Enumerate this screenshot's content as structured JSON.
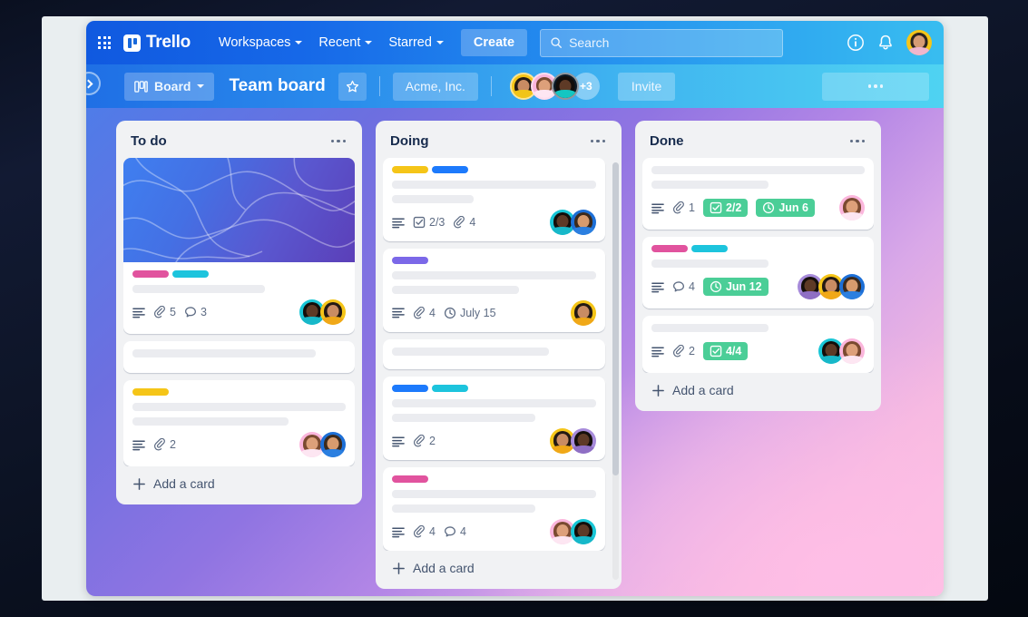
{
  "topnav": {
    "apps_icon": "apps-grid-icon",
    "brand": "Trello",
    "items": [
      {
        "label": "Workspaces",
        "has_caret": true
      },
      {
        "label": "Recent",
        "has_caret": true
      },
      {
        "label": "Starred",
        "has_caret": true
      }
    ],
    "create_label": "Create",
    "search_placeholder": "Search",
    "search_value": "",
    "info_icon": "info-icon",
    "bell_icon": "notifications-bell-icon",
    "avatar": "user-avatar"
  },
  "board_header": {
    "sidebar_toggle": "sidebar-expand-icon",
    "view_label": "Board",
    "title": "Team board",
    "star_icon": "star-icon",
    "workspace": "Acme, Inc.",
    "members_overflow": "+3",
    "invite_label": "Invite",
    "menu_icon": "board-menu-ellipsis"
  },
  "colors": {
    "brand_blue": "#1868db",
    "label_pink": "#e1539e",
    "label_cyan": "#1dc4dd",
    "label_yellow": "#f5c518",
    "label_blue": "#1d7afc",
    "label_purple": "#7b68e8",
    "badge_green": "#4bce97",
    "list_bg": "#f1f2f4",
    "card_bg": "#ffffff",
    "text_dark": "#172b4d",
    "text_muted": "#5e6c84"
  },
  "lists": [
    {
      "title": "To do",
      "add_card_label": "Add a card",
      "scrollbar": false,
      "cards": [
        {
          "cover": true,
          "labels": [
            "#e1539e",
            "#1dc4dd"
          ],
          "placeholder_lines": [
            62
          ],
          "badges": [
            {
              "type": "description"
            },
            {
              "type": "attachment",
              "value": "5"
            },
            {
              "type": "comment",
              "value": "3"
            }
          ],
          "members": [
            "cyan-dark",
            "yellow-dark"
          ]
        },
        {
          "cover": false,
          "labels": [],
          "placeholder_lines": [
            86
          ],
          "badges": [],
          "members": []
        },
        {
          "cover": false,
          "labels": [
            "#f5c518"
          ],
          "placeholder_lines": [
            100,
            73
          ],
          "badges": [
            {
              "type": "description"
            },
            {
              "type": "attachment",
              "value": "2"
            }
          ],
          "members": [
            "pink-light",
            "blue-mid"
          ]
        }
      ]
    },
    {
      "title": "Doing",
      "add_card_label": "Add a card",
      "scrollbar": true,
      "cards": [
        {
          "cover": false,
          "labels": [
            "#f5c518",
            "#1d7afc"
          ],
          "placeholder_lines": [
            100,
            40
          ],
          "badges": [
            {
              "type": "description"
            },
            {
              "type": "checklist",
              "value": "2/3"
            },
            {
              "type": "attachment",
              "value": "4"
            }
          ],
          "members": [
            "cyan-dark",
            "blue-mid"
          ]
        },
        {
          "cover": false,
          "labels": [
            "#7b68e8"
          ],
          "placeholder_lines": [
            100,
            62
          ],
          "badges": [
            {
              "type": "description"
            },
            {
              "type": "attachment",
              "value": "4"
            },
            {
              "type": "due",
              "value": "July 15"
            }
          ],
          "members": [
            "yellow-dark"
          ]
        },
        {
          "cover": false,
          "labels": [],
          "placeholder_lines": [
            77
          ],
          "badges": [],
          "members": []
        },
        {
          "cover": false,
          "labels": [
            "#1d7afc",
            "#1dc4dd"
          ],
          "placeholder_lines": [
            100,
            70
          ],
          "badges": [
            {
              "type": "description"
            },
            {
              "type": "attachment",
              "value": "2"
            }
          ],
          "members": [
            "yellow-dark",
            "purple-dark"
          ]
        },
        {
          "cover": false,
          "labels": [
            "#e1539e"
          ],
          "placeholder_lines": [
            100,
            70
          ],
          "badges": [
            {
              "type": "description"
            },
            {
              "type": "attachment",
              "value": "4"
            },
            {
              "type": "comment",
              "value": "4"
            }
          ],
          "members": [
            "pink-light",
            "cyan-dark"
          ]
        }
      ]
    },
    {
      "title": "Done",
      "add_card_label": "Add a card",
      "scrollbar": false,
      "cards": [
        {
          "cover": false,
          "labels": [],
          "placeholder_lines": [
            100,
            55
          ],
          "badges": [
            {
              "type": "description"
            },
            {
              "type": "attachment",
              "value": "1"
            },
            {
              "type": "checklist-done",
              "value": "2/2"
            },
            {
              "type": "due-done",
              "value": "Jun 6"
            }
          ],
          "members": [
            "pink-light"
          ]
        },
        {
          "cover": false,
          "labels": [
            "#e1539e",
            "#1dc4dd"
          ],
          "placeholder_lines": [
            55
          ],
          "badges": [
            {
              "type": "description"
            },
            {
              "type": "comment",
              "value": "4"
            },
            {
              "type": "due-done",
              "value": "Jun 12"
            }
          ],
          "members": [
            "purple-dark",
            "yellow-dark",
            "blue-mid"
          ]
        },
        {
          "cover": false,
          "labels": [],
          "placeholder_lines": [
            55
          ],
          "badges": [
            {
              "type": "description"
            },
            {
              "type": "attachment",
              "value": "2"
            },
            {
              "type": "checklist-done",
              "value": "4/4"
            }
          ],
          "members": [
            "cyan-dark",
            "pink-light"
          ]
        }
      ]
    }
  ]
}
